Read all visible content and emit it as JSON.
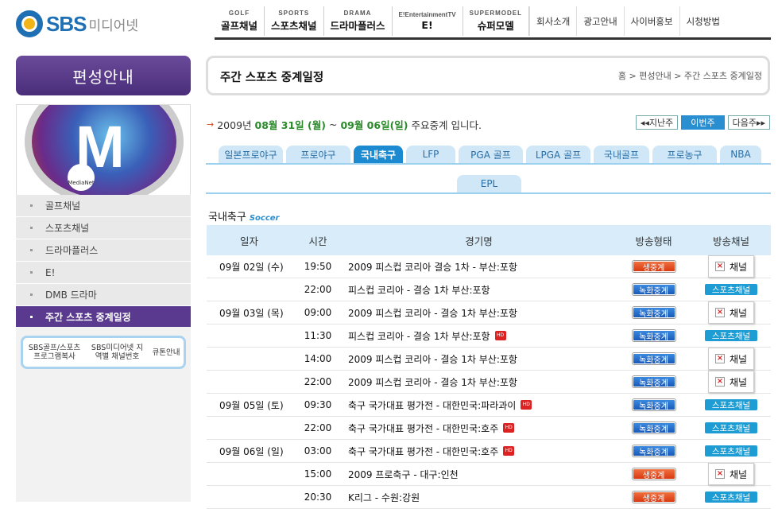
{
  "logo": {
    "brand": "SBS",
    "sub": "미디어넷"
  },
  "topnav": [
    {
      "en": "GOLF",
      "ko": "골프채널"
    },
    {
      "en": "SPORTS",
      "ko": "스포츠채널"
    },
    {
      "en": "DRAMA",
      "ko": "드라마플러스"
    },
    {
      "en": "E!EntertainmentTV",
      "ko": "E!"
    },
    {
      "en": "SUPERMODEL",
      "ko": "슈퍼모델"
    }
  ],
  "toplinks": [
    "회사소개",
    "광고안내",
    "사이버홍보",
    "시청방법"
  ],
  "sidebar": {
    "title": "편성안내",
    "picture": {
      "letter": "M",
      "tv": "MediaNet"
    },
    "items": [
      "골프채널",
      "스포츠채널",
      "드라마플러스",
      "E!",
      "DMB 드라마",
      "주간 스포츠 중계일정"
    ],
    "buttons": [
      "SBS골프/스포츠 프로그램복사",
      "SBS미디어넷 지역별 채널번호",
      "큐톤안내"
    ]
  },
  "page": {
    "title": "주간 스포츠 중계일정",
    "breadcrumb": "홈 > 편성안내 > 주간 스포츠 중계일정"
  },
  "week": {
    "year": "2009년",
    "start": "08월 31일 (월)",
    "sep": "~",
    "end": "09월 06일(일)",
    "suffix": "주요중계 입니다.",
    "prev": "◂◂지난주",
    "current": "이번주",
    "next": "다음주▸▸"
  },
  "tabs": [
    "일본프로야구",
    "프로야구",
    "국내축구",
    "LFP",
    "PGA 골프",
    "LPGA 골프",
    "국내골프",
    "프로농구",
    "NBA"
  ],
  "tabs_row2": [
    "EPL"
  ],
  "active_tab": "국내축구",
  "section": {
    "title": "국내축구",
    "en": "Soccer"
  },
  "table": {
    "headers": [
      "일자",
      "시간",
      "경기명",
      "방송형태",
      "방송채널"
    ],
    "rows": [
      {
        "date": "09월 02일 (수)",
        "time": "19:50",
        "title": "2009 피스컵 코리아 결승 1차 - 부산:포항",
        "hd": false,
        "type": "생중계",
        "channel": "채널",
        "channel_img": true
      },
      {
        "date": "",
        "time": "22:00",
        "title": "피스컵 코리아 - 결승 1차 부산:포항",
        "hd": false,
        "type": "녹화중계",
        "channel": "스포츠채널",
        "channel_img": false
      },
      {
        "date": "09월 03일 (목)",
        "time": "09:00",
        "title": "2009 피스컵 코리아 - 결승 1차 부산:포항",
        "hd": false,
        "type": "녹화중계",
        "channel": "채널",
        "channel_img": true
      },
      {
        "date": "",
        "time": "11:30",
        "title": "피스컵 코리아 - 결승 1차 부산:포항",
        "hd": true,
        "type": "녹화중계",
        "channel": "스포츠채널",
        "channel_img": false
      },
      {
        "date": "",
        "time": "14:00",
        "title": "2009 피스컵 코리아 - 결승 1차 부산:포항",
        "hd": false,
        "type": "녹화중계",
        "channel": "채널",
        "channel_img": true
      },
      {
        "date": "",
        "time": "22:00",
        "title": "2009 피스컵 코리아 - 결승 1차 부산:포항",
        "hd": false,
        "type": "녹화중계",
        "channel": "채널",
        "channel_img": true
      },
      {
        "date": "09월 05일 (토)",
        "time": "09:30",
        "title": "축구 국가대표 평가전 - 대한민국:파라과이",
        "hd": true,
        "type": "녹화중계",
        "channel": "스포츠채널",
        "channel_img": false
      },
      {
        "date": "",
        "time": "22:00",
        "title": "축구 국가대표 평가전 - 대한민국:호주",
        "hd": true,
        "type": "녹화중계",
        "channel": "스포츠채널",
        "channel_img": false
      },
      {
        "date": "09월 06일 (일)",
        "time": "03:00",
        "title": "축구 국가대표 평가전 - 대한민국:호주",
        "hd": true,
        "type": "녹화중계",
        "channel": "스포츠채널",
        "channel_img": false
      },
      {
        "date": "",
        "time": "15:00",
        "title": "2009 프로축구 - 대구:인천",
        "hd": false,
        "type": "생중계",
        "channel": "채널",
        "channel_img": true
      },
      {
        "date": "",
        "time": "20:30",
        "title": "K리그 - 수원:강원",
        "hd": false,
        "type": "생중계",
        "channel": "스포츠채널",
        "channel_img": false
      }
    ]
  },
  "hd_label": "HD",
  "colors": {
    "purple": "#5a3a8e",
    "blue": "#1b8ad0",
    "live": "#d83a10",
    "rec": "#1a5ab8"
  }
}
